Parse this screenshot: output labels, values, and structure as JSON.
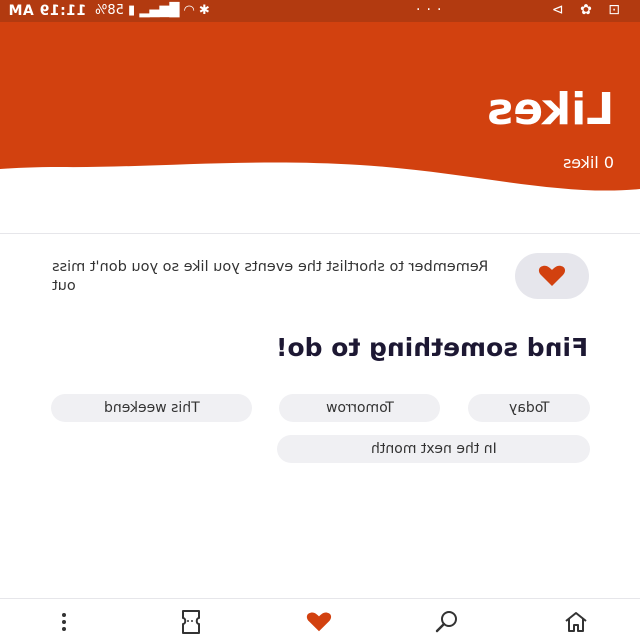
{
  "status_bar": {
    "time": "11:19 AM",
    "battery": "58%",
    "right_icons": "··· ✈ ✿ ✕"
  },
  "header": {
    "title": "Likes",
    "likes_count": "0 likes",
    "color": "#d2410f"
  },
  "reminder": {
    "icon": "heart-icon",
    "text": "Remember to shortlist the events you like so you don't miss out"
  },
  "find_section": {
    "title": "Find something to do!",
    "chips": [
      "Today",
      "Tomorrow",
      "This weekend",
      "In the next month"
    ]
  },
  "bottom_nav": {
    "items": [
      "home-icon",
      "search-icon",
      "heart-icon",
      "ticket-icon",
      "more-icon"
    ],
    "active": "heart-icon",
    "accent": "#d2410f"
  }
}
